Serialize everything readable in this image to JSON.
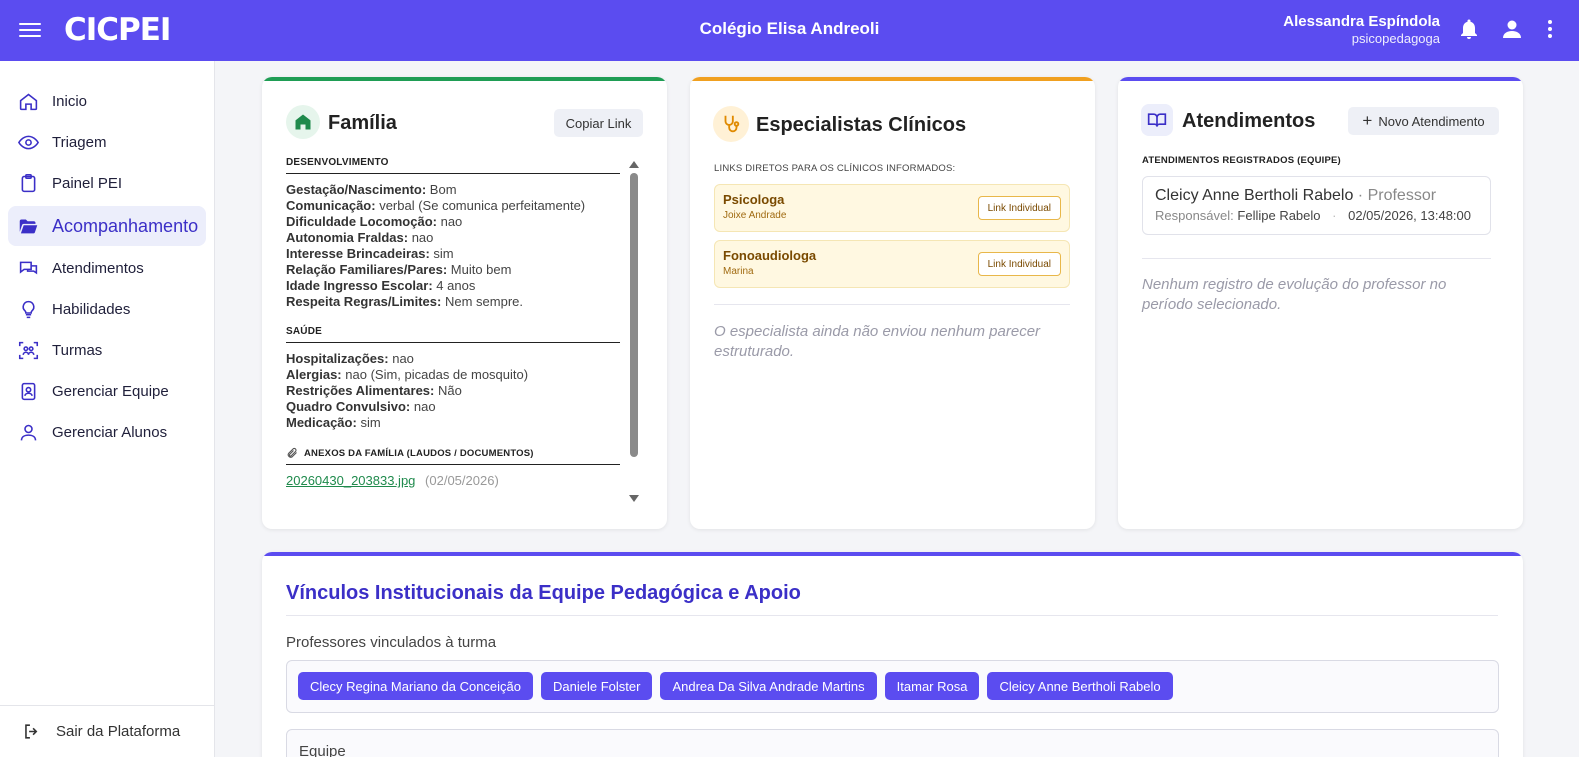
{
  "header": {
    "logo": "CICPEI",
    "school_name": "Colégio Elisa Andreoli",
    "user_name": "Alessandra Espíndola",
    "user_role": "psicopedagoga",
    "icons": [
      "menu-icon",
      "bell-icon",
      "user-icon",
      "more-vertical-icon"
    ]
  },
  "sidebar": {
    "items": [
      {
        "label": "Inicio",
        "icon": "home-icon"
      },
      {
        "label": "Triagem",
        "icon": "eye-icon"
      },
      {
        "label": "Painel PEI",
        "icon": "clipboard-icon"
      },
      {
        "label": "Acompanhamento",
        "icon": "folder-open-icon",
        "active": true
      },
      {
        "label": "Atendimentos",
        "icon": "chat-icon"
      },
      {
        "label": "Habilidades",
        "icon": "lightbulb-icon"
      },
      {
        "label": "Turmas",
        "icon": "users-scan-icon"
      },
      {
        "label": "Gerenciar Equipe",
        "icon": "badge-icon"
      },
      {
        "label": "Gerenciar Alunos",
        "icon": "person-icon"
      }
    ],
    "logout_label": "Sair da Plataforma"
  },
  "familia": {
    "title": "Família",
    "copy_link_label": "Copiar Link",
    "desenvolvimento_label": "DESENVOLVIMENTO",
    "desenvolvimento": [
      {
        "k": "Gestação/Nascimento:",
        "v": "Bom"
      },
      {
        "k": "Comunicação:",
        "v": "verbal (Se comunica perfeitamente)"
      },
      {
        "k": "Dificuldade Locomoção:",
        "v": "nao"
      },
      {
        "k": "Autonomia Fraldas:",
        "v": "nao"
      },
      {
        "k": "Interesse Brincadeiras:",
        "v": "sim"
      },
      {
        "k": "Relação Familiares/Pares:",
        "v": "Muito bem"
      },
      {
        "k": "Idade Ingresso Escolar:",
        "v": "4 anos"
      },
      {
        "k": "Respeita Regras/Limites:",
        "v": "Nem sempre."
      }
    ],
    "saude_label": "SAÚDE",
    "saude": [
      {
        "k": "Hospitalizações:",
        "v": "nao"
      },
      {
        "k": "Alergias:",
        "v": "nao (Sim, picadas de mosquito)"
      },
      {
        "k": "Restrições Alimentares:",
        "v": "Não"
      },
      {
        "k": "Quadro Convulsivo:",
        "v": "nao"
      },
      {
        "k": "Medicação:",
        "v": "sim"
      }
    ],
    "anexos_label": "ANEXOS DA FAMÍLIA (LAUDOS / DOCUMENTOS)",
    "anexo_file": "20260430_203833.jpg",
    "anexo_date": "(02/05/2026)",
    "accent": "#1f9d55"
  },
  "especialistas": {
    "title": "Especialistas Clínicos",
    "subtitle": "LINKS DIRETOS PARA OS CLÍNICOS INFORMADOS:",
    "items": [
      {
        "name": "Psicologa",
        "person": "Joixe Andrade",
        "link_label": "Link Individual"
      },
      {
        "name": "Fonoaudiologa",
        "person": "Marina",
        "link_label": "Link Individual"
      }
    ],
    "empty_text": "O especialista ainda não enviou nenhum parecer estruturado.",
    "accent": "#f0a020"
  },
  "atendimentos": {
    "title": "Atendimentos",
    "new_button_label": "Novo Atendimento",
    "section_label": "ATENDIMENTOS REGISTRADOS (EQUIPE)",
    "record": {
      "name": "Cleicy Anne Bertholi Rabelo",
      "role": "· Professor",
      "resp_label": "Responsável:",
      "resp_name": "Fellipe Rabelo",
      "datetime": "02/05/2026, 13:48:00"
    },
    "empty_text": "Nenhum registro de evolução do professor no período selecionado.",
    "accent": "#5b4cf0"
  },
  "vinculos": {
    "title": "Vínculos Institucionais da Equipe Pedagógica e Apoio",
    "professores_label": "Professores vinculados à turma",
    "professores": [
      "Clecy Regina Mariano da Conceição",
      "Daniele Folster",
      "Andrea Da Silva Andrade Martins",
      "Itamar Rosa",
      "Cleicy Anne Bertholi Rabelo"
    ],
    "equipe_label": "Equipe"
  }
}
